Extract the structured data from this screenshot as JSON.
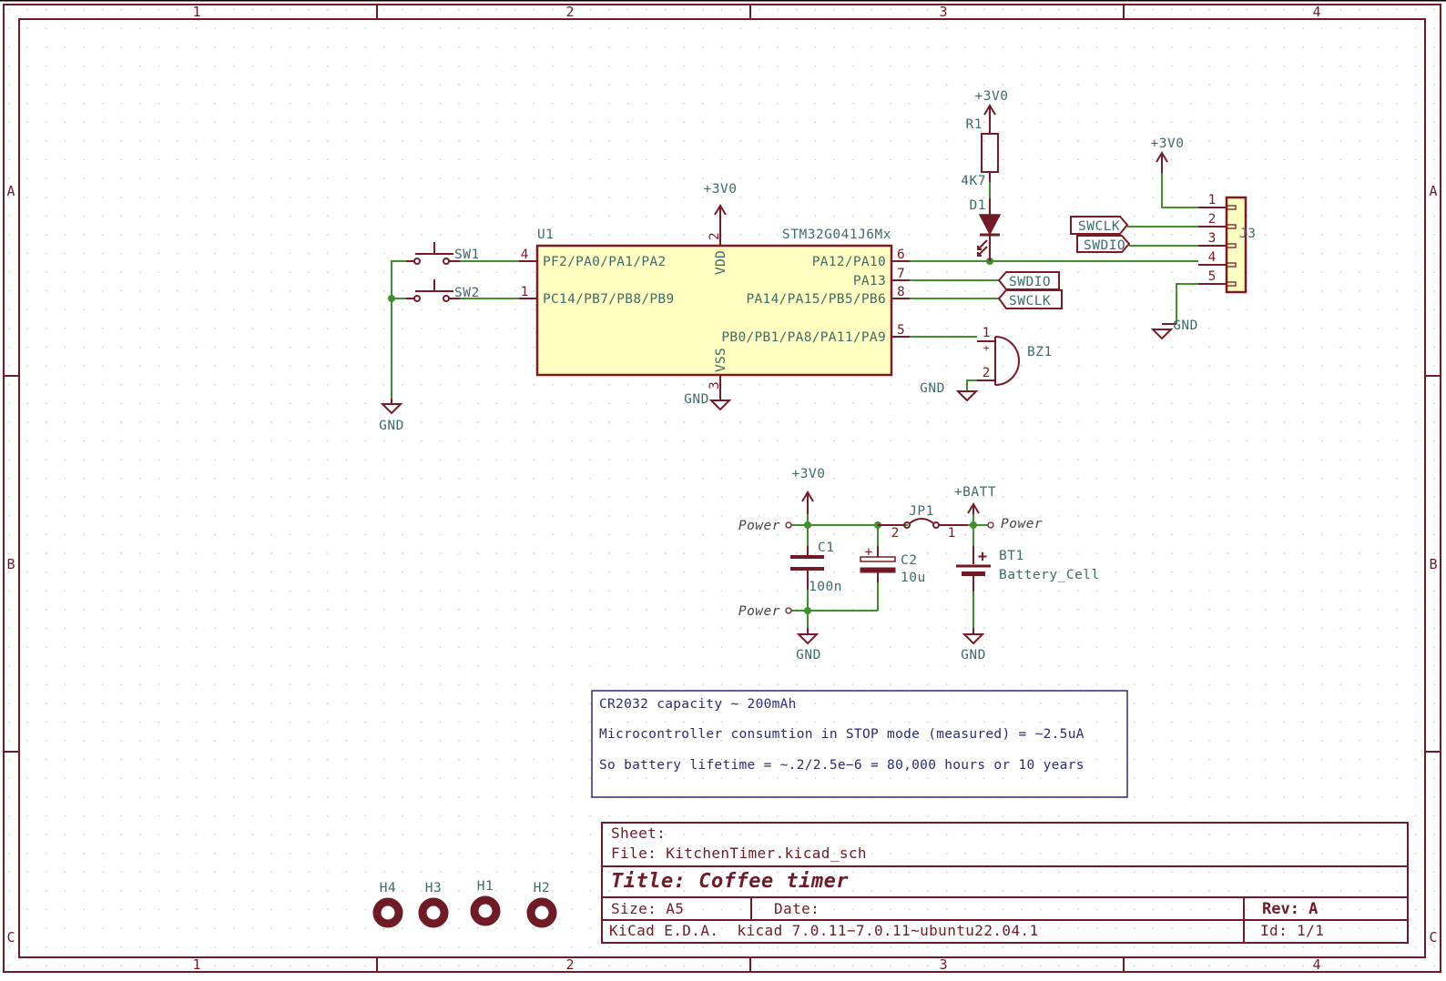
{
  "frame": {
    "columns": [
      "1",
      "2",
      "3",
      "4"
    ],
    "rows": [
      "A",
      "B",
      "C"
    ]
  },
  "components": {
    "U1": {
      "ref": "U1",
      "value": "STM32G041J6Mx",
      "pins_left": [
        {
          "num": "4",
          "name": "PF2/PA0/PA1/PA2"
        },
        {
          "num": "1",
          "name": "PC14/PB7/PB8/PB9"
        }
      ],
      "pins_right": [
        {
          "num": "6",
          "name": "PA12/PA10"
        },
        {
          "num": "7",
          "name": "PA13"
        },
        {
          "num": "8",
          "name": "PA14/PA15/PB5/PB6"
        },
        {
          "num": "5",
          "name": "PB0/PB1/PA8/PA11/PA9"
        }
      ],
      "pin_top": {
        "num": "2",
        "name": "VDD"
      },
      "pin_bottom": {
        "num": "3",
        "name": "VSS"
      }
    },
    "SW1": {
      "ref": "SW1"
    },
    "SW2": {
      "ref": "SW2"
    },
    "R1": {
      "ref": "R1",
      "value": "4K7"
    },
    "D1": {
      "ref": "D1"
    },
    "BZ1": {
      "ref": "BZ1",
      "pin1": "1",
      "pin2": "2",
      "plus": "+"
    },
    "J3": {
      "ref": "J3",
      "pins": [
        "1",
        "2",
        "3",
        "4",
        "5"
      ]
    },
    "C1": {
      "ref": "C1",
      "value": "100n"
    },
    "C2": {
      "ref": "C2",
      "value": "10u",
      "plus": "+"
    },
    "JP1": {
      "ref": "JP1",
      "pin1": "1",
      "pin2": "2"
    },
    "BT1": {
      "ref": "BT1",
      "value": "Battery_Cell",
      "plus": "+"
    },
    "H1": {
      "ref": "H1"
    },
    "H2": {
      "ref": "H2"
    },
    "H3": {
      "ref": "H3"
    },
    "H4": {
      "ref": "H4"
    }
  },
  "power": {
    "v3": "+3V0",
    "gnd": "GND",
    "batt": "+BATT",
    "power_flag": "Power"
  },
  "labels": {
    "swdio": "SWDIO",
    "swclk": "SWCLK"
  },
  "note": {
    "lines": [
      "CR2032 capacity ~ 200mAh",
      "Microcontroller consumtion in STOP mode (measured) = ~2.5uA",
      "So battery lifetime = ~.2/2.5e−6 = 80,000 hours or 10 years"
    ]
  },
  "title_block": {
    "sheet": "Sheet:",
    "file": "File: KitchenTimer.kicad_sch",
    "title": "Title: Coffee timer",
    "size": "Size: A5",
    "date": "Date:",
    "rev": "Rev: A",
    "tool": "KiCad E.D.A.  kicad 7.0.11−7.0.11~ubuntu22.04.1",
    "id": "Id: 1/1"
  }
}
